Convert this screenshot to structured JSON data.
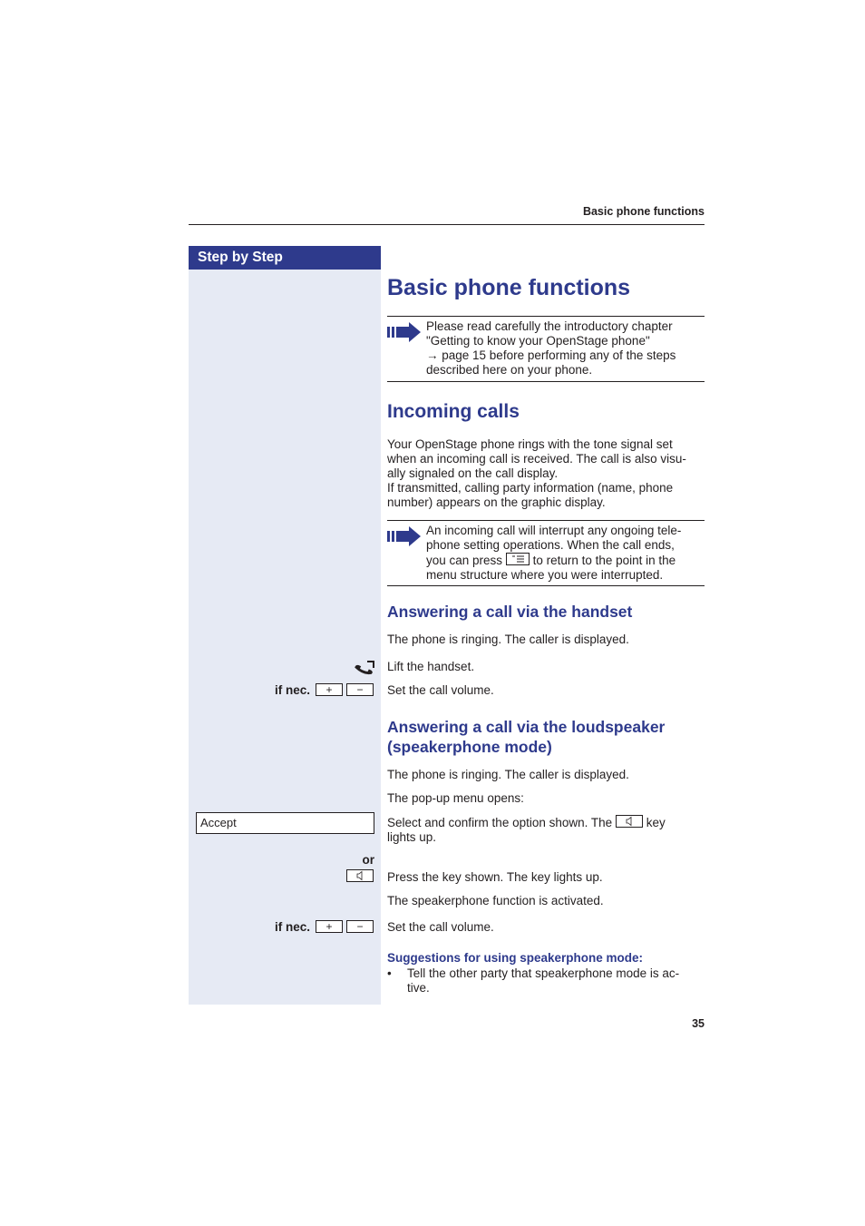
{
  "running_head": "Basic phone functions",
  "sidebar_title": "Step by Step",
  "title": "Basic phone functions",
  "intro_note": {
    "icon": "note-arrow-icon",
    "lines": [
      "Please read carefully the introductory chapter",
      "\"Getting to know your OpenStage phone\"",
      "→ page 15 before performing any of the steps",
      "described here on your phone."
    ]
  },
  "incoming_calls": {
    "heading": "Incoming calls",
    "paragraph_lines": [
      "Your OpenStage phone rings with the tone signal set",
      "when an incoming call is received. The call is also visu-",
      "ally signaled on the call display.",
      "If transmitted, calling party information (name, phone",
      "number) appears on the graphic display."
    ],
    "note": {
      "icon": "note-arrow-icon",
      "line1": "An incoming call will interrupt any ongoing tele-",
      "line2": "phone setting operations. When the call ends,",
      "line3_before": "you can press",
      "line3_key_icon": "menu-key-icon",
      "line3_after": "to return to the point in the",
      "line4": "menu structure where you were interrupted."
    }
  },
  "handset_section": {
    "heading": "Answering a call via the handset",
    "intro": "The phone is ringing. The caller is displayed.",
    "steps": [
      {
        "left_icon": "lift-handset-icon",
        "text": "Lift the handset."
      },
      {
        "left_label": "if nec.",
        "keys": [
          "+",
          "−"
        ],
        "text": "Set the call volume."
      }
    ]
  },
  "speaker_section": {
    "heading_line1": "Answering a call via the loudspeaker",
    "heading_line2": "(speakerphone mode)",
    "intro": "The phone is ringing. The caller is displayed.",
    "popup": "The pop-up menu opens:",
    "accept_option": "Accept",
    "select_text_before": "Select and confirm the option shown. The",
    "select_key_icon": "loudspeaker-key-icon",
    "select_text_after": "key",
    "select_text_line2": "lights up.",
    "or_label": "or",
    "press_text": "Press the key shown. The key lights up.",
    "activated_text": "The speakerphone function is activated.",
    "volume_label": "if nec.",
    "volume_keys": [
      "+",
      "−"
    ],
    "volume_text": "Set the call volume."
  },
  "suggestions": {
    "heading": "Suggestions for using speakerphone mode:",
    "bullet": "•",
    "item_line1": "Tell the other party that speakerphone mode is ac-",
    "item_line2": "tive."
  },
  "page_number": "35"
}
